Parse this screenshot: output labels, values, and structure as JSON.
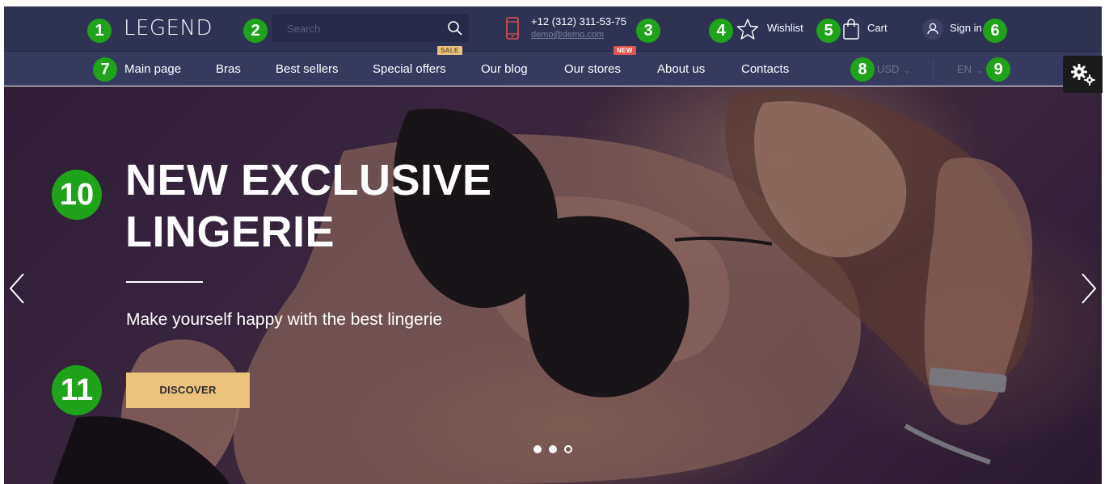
{
  "header": {
    "logo": "LEGEND",
    "search_placeholder": "Search",
    "phone": "+12 (312) 311-53-75",
    "email": "demo@demo.com",
    "wishlist": "Wishlist",
    "cart": "Cart",
    "signin": "Sign in"
  },
  "nav": {
    "items": [
      {
        "label": "Main page"
      },
      {
        "label": "Bras"
      },
      {
        "label": "Best sellers"
      },
      {
        "label": "Special offers",
        "badge": "SALE"
      },
      {
        "label": "Our blog"
      },
      {
        "label": "Our stores",
        "badge": "NEW"
      },
      {
        "label": "About us"
      },
      {
        "label": "Contacts"
      }
    ],
    "currency": "USD",
    "language": "EN"
  },
  "hero": {
    "title_line1": "NEW EXCLUSIVE",
    "title_line2": "LINGERIE",
    "subtitle": "Make yourself happy with the best lingerie",
    "cta": "DISCOVER",
    "slides": 3,
    "active_slide": 1
  },
  "annotations": [
    "1",
    "2",
    "3",
    "4",
    "5",
    "6",
    "7",
    "8",
    "9",
    "10",
    "11"
  ],
  "colors": {
    "topbar": "#2e3253",
    "navbar": "#353a5e",
    "accent_button": "#ecc27f",
    "sale_badge": "#e8c27e",
    "new_badge": "#e0524b",
    "marker": "#1fa31a"
  },
  "icons": [
    "search-icon",
    "phone-icon",
    "star-icon",
    "bag-icon",
    "user-icon",
    "chevron-down-icon",
    "gears-icon",
    "chevron-left-icon",
    "chevron-right-icon"
  ]
}
